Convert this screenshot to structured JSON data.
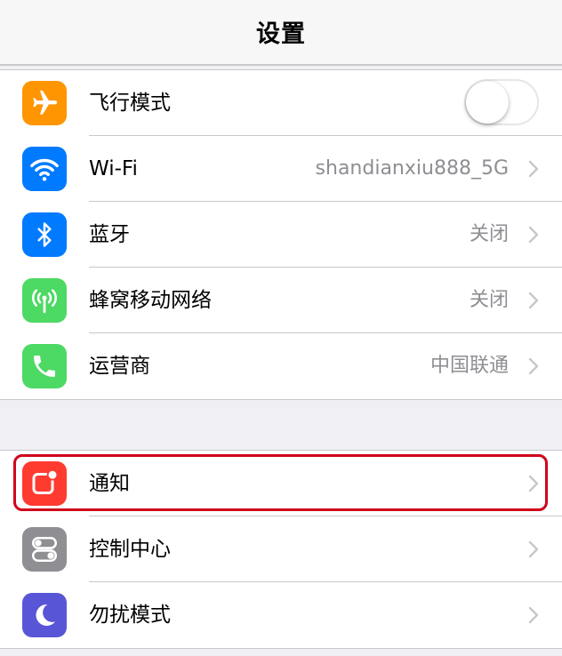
{
  "navbar": {
    "title": "设置"
  },
  "group1": [
    {
      "label": "飞行模式",
      "icon": "airplane-icon",
      "color": "#ff9500",
      "toggle": false
    },
    {
      "label": "Wi-Fi",
      "icon": "wifi-icon",
      "color": "#007aff",
      "value": "shandianxiu888_5G"
    },
    {
      "label": "蓝牙",
      "icon": "bluetooth-icon",
      "color": "#007aff",
      "value": "关闭"
    },
    {
      "label": "蜂窝移动网络",
      "icon": "cellular-icon",
      "color": "#4cd964",
      "value": "关闭"
    },
    {
      "label": "运营商",
      "icon": "phone-icon",
      "color": "#4cd964",
      "value": "中国联通"
    }
  ],
  "group2": [
    {
      "label": "通知",
      "icon": "notifications-icon",
      "color": "#ff3b30",
      "highlighted": true
    },
    {
      "label": "控制中心",
      "icon": "control-center-icon",
      "color": "#8e8e93"
    },
    {
      "label": "勿扰模式",
      "icon": "moon-icon",
      "color": "#5856d6"
    }
  ],
  "colors": {
    "highlight": "#d0021b",
    "separator": "#c8c7cc",
    "value_text": "#8e8e93"
  }
}
